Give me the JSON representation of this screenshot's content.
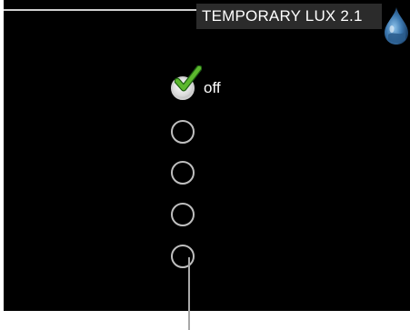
{
  "header": {
    "title": "TEMPORARY LUX 2.1",
    "icon": "water-drop-icon"
  },
  "options": [
    {
      "label": "off",
      "selected": true
    },
    {
      "label": "",
      "selected": false
    },
    {
      "label": "",
      "selected": false
    },
    {
      "label": "",
      "selected": false
    },
    {
      "label": "",
      "selected": false
    }
  ],
  "colors": {
    "screen_background": "#000000",
    "title_background": "#2b2b2b",
    "checkmark_green": "#5cb82e",
    "radio_outline": "#bfbfbf",
    "drop_blue": "#2f6fa8"
  }
}
